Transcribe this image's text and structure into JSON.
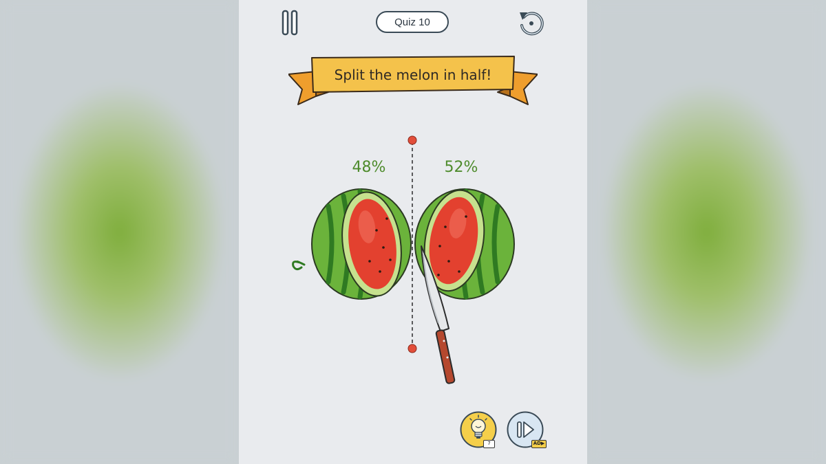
{
  "header": {
    "level_label": "Quiz 10",
    "pause_icon": "pause-icon",
    "restart_icon": "restart-icon"
  },
  "banner": {
    "instruction": "Split the melon in half!"
  },
  "result": {
    "left_percent": "48%",
    "right_percent": "52%"
  },
  "scene": {
    "object": "watermelon-icon",
    "tool": "knife-icon"
  },
  "footer": {
    "hint_icon": "lightbulb-icon",
    "hint_count": "7",
    "skip_icon": "skip-icon",
    "skip_badge": "AD▶"
  },
  "colors": {
    "accent_green": "#4e8b2c",
    "banner_yellow": "#f4c24b",
    "cut_marker_red": "#e24e3a",
    "button_yellow": "#f5cf4a",
    "button_blue": "#d8e6f2"
  }
}
